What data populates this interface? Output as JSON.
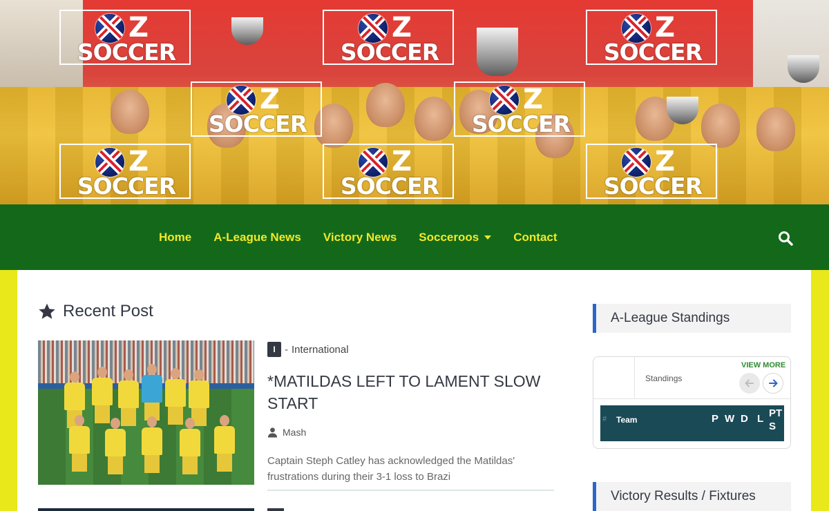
{
  "banner": {
    "logo_letter": "Z",
    "logo_word": "SOCCER",
    "logo_count": 8
  },
  "nav": {
    "items": [
      {
        "label": "Home"
      },
      {
        "label": "A-League News"
      },
      {
        "label": "Victory News"
      },
      {
        "label": "Socceroos",
        "has_dropdown": true
      },
      {
        "label": "Contact"
      }
    ],
    "search_icon": "search-icon"
  },
  "main": {
    "section_title": "Recent Post",
    "section_icon": "star-icon",
    "post": {
      "category_badge": "I",
      "category_separator": "-",
      "category": "International",
      "title": "*MATILDAS LEFT TO LAMENT SLOW START",
      "author": "Mash",
      "excerpt": "Captain Steph Catley has acknowledged the Matildas' frustrations during their 3-1 loss to Brazi"
    }
  },
  "sidebar": {
    "standings_widget_title": "A-League Standings",
    "standings": {
      "label": "Standings",
      "view_more": "VIEW MORE",
      "columns": {
        "hash": "#",
        "team": "Team",
        "p": "P",
        "w": "W",
        "d": "D",
        "l": "L",
        "pts": "PTS"
      }
    },
    "results_widget_title": "Victory Results / Fixtures"
  },
  "colors": {
    "page_bg": "#e8e81a",
    "nav_bg": "#136919",
    "nav_text": "#f0e92a",
    "widget_accent": "#2a67c8",
    "table_header_bg": "#1b4a57",
    "view_more": "#2f8a2f"
  }
}
